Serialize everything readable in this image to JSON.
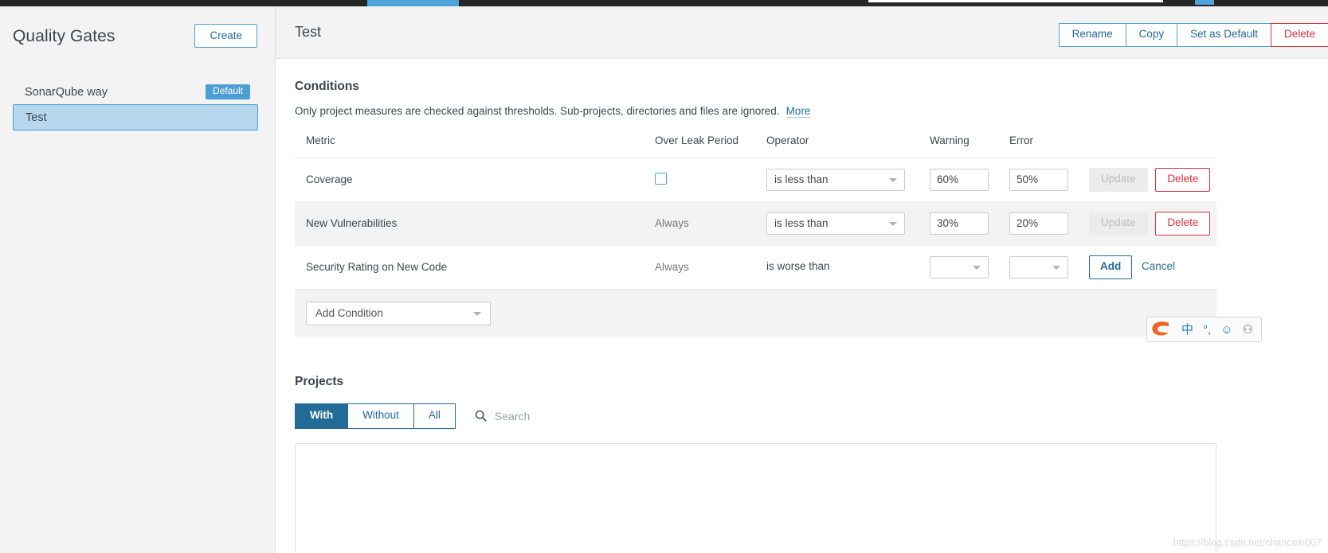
{
  "sidebar": {
    "title": "Quality Gates",
    "create_label": "Create",
    "gates": [
      {
        "name": "SonarQube way",
        "badge": "Default",
        "selected": false
      },
      {
        "name": "Test",
        "badge": "",
        "selected": true
      }
    ]
  },
  "header": {
    "title": "Test",
    "actions": [
      {
        "label": "Rename",
        "style": "normal"
      },
      {
        "label": "Copy",
        "style": "normal"
      },
      {
        "label": "Set as Default",
        "style": "normal"
      },
      {
        "label": "Delete",
        "style": "danger"
      }
    ]
  },
  "conditions": {
    "title": "Conditions",
    "description": "Only project measures are checked against thresholds. Sub-projects, directories and files are ignored.",
    "more_label": "More",
    "columns": [
      "Metric",
      "Over Leak Period",
      "Operator",
      "Warning",
      "Error",
      ""
    ],
    "rows": [
      {
        "metric": "Coverage",
        "leak_type": "checkbox",
        "leak_checked": false,
        "leak_text": "",
        "operator": "is less than",
        "operator_type": "select",
        "warning": "60%",
        "error": "50%",
        "warning_type": "input",
        "error_type": "input",
        "actions": [
          {
            "label": "Update",
            "style": "disabled"
          },
          {
            "label": "Delete",
            "style": "danger-outline"
          }
        ],
        "alt": false
      },
      {
        "metric": "New Vulnerabilities",
        "leak_type": "text",
        "leak_checked": false,
        "leak_text": "Always",
        "operator": "is less than",
        "operator_type": "select",
        "warning": "30%",
        "error": "20%",
        "warning_type": "input",
        "error_type": "input",
        "actions": [
          {
            "label": "Update",
            "style": "disabled"
          },
          {
            "label": "Delete",
            "style": "danger-outline"
          }
        ],
        "alt": true
      },
      {
        "metric": "Security Rating on New Code",
        "leak_type": "text",
        "leak_checked": false,
        "leak_text": "Always",
        "operator": "is worse than",
        "operator_type": "static",
        "warning": "",
        "error": "",
        "warning_type": "select",
        "error_type": "select",
        "actions": [
          {
            "label": "Add",
            "style": "primary-outline"
          },
          {
            "label": "Cancel",
            "style": "link"
          }
        ],
        "alt": false
      }
    ],
    "add_condition_label": "Add Condition"
  },
  "projects": {
    "title": "Projects",
    "filters": [
      {
        "label": "With",
        "active": true
      },
      {
        "label": "Without",
        "active": false
      },
      {
        "label": "All",
        "active": false
      }
    ],
    "search_placeholder": "Search"
  },
  "ime": {
    "items": [
      {
        "glyph": "S",
        "name": "sogou-logo-icon",
        "color": "orange"
      },
      {
        "glyph": "中",
        "name": "chinese-mode-icon",
        "color": "blue"
      },
      {
        "glyph": "°,",
        "name": "punctuation-icon",
        "color": "blue"
      },
      {
        "glyph": "☺",
        "name": "emoji-icon",
        "color": "blue"
      },
      {
        "glyph": "⚇",
        "name": "toolbox-icon",
        "color": "gray"
      }
    ]
  },
  "watermark": "https://blog.csdn.net/chancein007",
  "colors": {
    "accent": "#236a97",
    "link": "#4b9fd5",
    "danger": "#d4333f",
    "selected_bg": "#b7d7ee",
    "alt_row": "#f3f3f3"
  }
}
